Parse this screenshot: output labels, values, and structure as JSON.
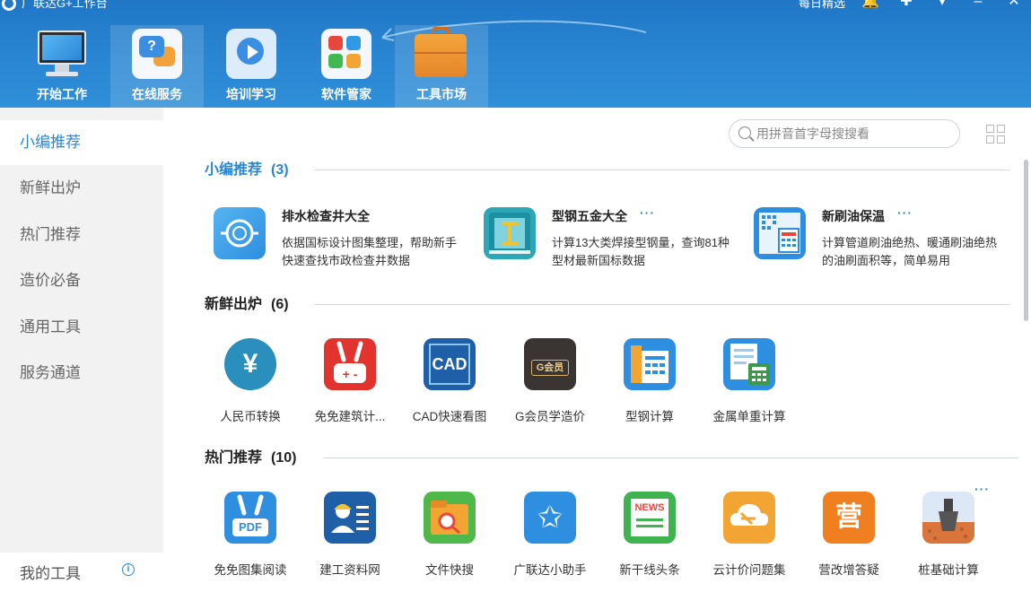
{
  "window": {
    "title": "广联达G+工作台",
    "daily_pick": "每日精选",
    "icons": [
      "bell-icon",
      "pin-icon",
      "chevron-down-icon",
      "minimize-icon",
      "close-icon"
    ]
  },
  "nav": {
    "tabs": [
      {
        "label": "开始工作",
        "icon": "monitor-icon"
      },
      {
        "label": "在线服务",
        "icon": "chat-bubbles-icon",
        "active": true
      },
      {
        "label": "培训学习",
        "icon": "video-play-icon"
      },
      {
        "label": "软件管家",
        "icon": "app-tiles-icon"
      },
      {
        "label": "工具市场",
        "icon": "briefcase-icon",
        "active": true
      }
    ]
  },
  "sidebar": {
    "items": [
      {
        "label": "小编推荐",
        "active": true
      },
      {
        "label": "新鲜出炉"
      },
      {
        "label": "热门推荐"
      },
      {
        "label": "造价必备"
      },
      {
        "label": "通用工具"
      },
      {
        "label": "服务通道"
      }
    ],
    "my_tools": "我的工具",
    "info_glyph": "i"
  },
  "search": {
    "placeholder": "用拼音首字母搜搜看"
  },
  "sections": {
    "recommend": {
      "title": "小编推荐",
      "count": "(3)",
      "items": [
        {
          "title": "排水检查井大全",
          "desc": "依据国标设计图集整理，帮助新手快速查找市政检查井数据",
          "has_more": false
        },
        {
          "title": "型钢五金大全",
          "desc": "计算13大类焊接型钢量，查询81种型材最新国标数据",
          "has_more": true
        },
        {
          "title": "新刷油保温",
          "desc": "计算管道刷油绝热、暖通刷油绝热的油刷面积等，简单易用",
          "has_more": true
        }
      ],
      "more_glyph": "···"
    },
    "fresh": {
      "title": "新鲜出炉",
      "count": "(6)",
      "items": [
        {
          "label": "人民币转换",
          "glyph": "¥"
        },
        {
          "label": "免免建筑计...",
          "glyph": "+ -"
        },
        {
          "label": "CAD快速看图",
          "glyph": "CAD"
        },
        {
          "label": "G会员学造价",
          "glyph": "G会员"
        },
        {
          "label": "型钢计算",
          "glyph": ""
        },
        {
          "label": "金属单重计算",
          "glyph": ""
        }
      ]
    },
    "hot": {
      "title": "热门推荐",
      "count": "(10)",
      "items": [
        {
          "label": "免免图集阅读",
          "glyph": "PDF"
        },
        {
          "label": "建工资料网",
          "glyph": ""
        },
        {
          "label": "文件快搜",
          "glyph": ""
        },
        {
          "label": "广联达小助手",
          "glyph": "✩"
        },
        {
          "label": "新干线头条",
          "glyph": "NEWS"
        },
        {
          "label": "云计价问题集",
          "glyph": ""
        },
        {
          "label": "营改增答疑",
          "glyph": "营"
        },
        {
          "label": "桩基础计算",
          "glyph": ""
        }
      ],
      "more_glyph": "···"
    }
  },
  "colors": {
    "header_blue": "#2a86d3",
    "accent_blue": "#2a86d3",
    "sidebar_bg": "#f2f2f2"
  }
}
